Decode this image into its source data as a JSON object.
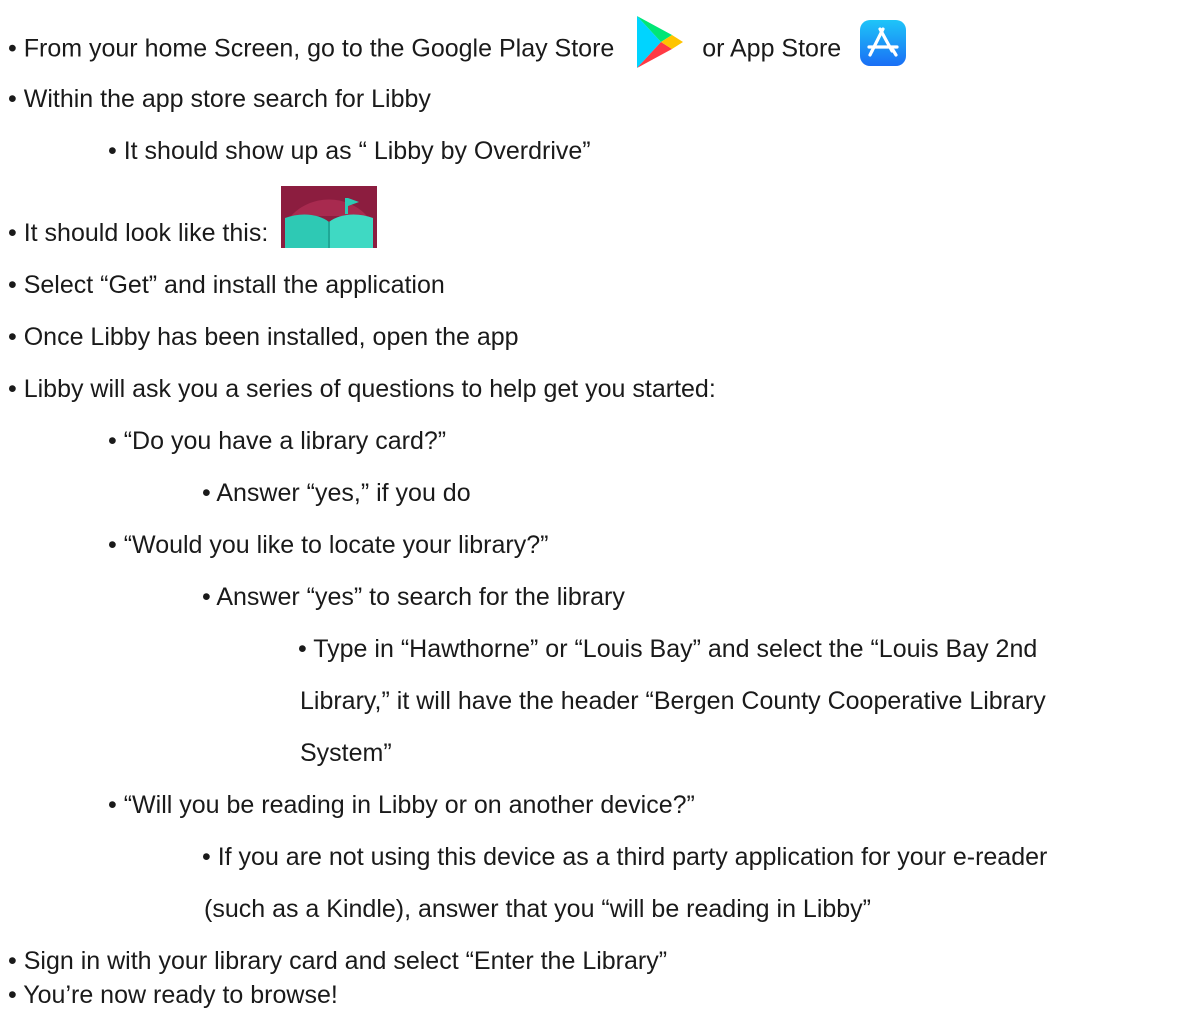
{
  "bullet": "•",
  "icons": {
    "google_play": "google-play-icon",
    "app_store": "app-store-icon",
    "libby": "libby-app-icon"
  },
  "colors": {
    "app_store_blue": "#1a8df5",
    "libby_maroon": "#8c1d3f",
    "libby_teal": "#2ec9b4"
  },
  "lines": {
    "l1_a": "From your home Screen, go to the Google Play Store",
    "l1_b": "or App Store",
    "l2": "Within the app store search for Libby",
    "l3": "It should show up as “ Libby by Overdrive”",
    "l4": "It should look like this:",
    "l5": "Select “Get” and install the application",
    "l6": "Once Libby has been installed, open the app",
    "l7": "Libby will ask you a series of questions to help get you started:",
    "l8": "“Do you have a library card?”",
    "l9": "Answer “yes,” if you do",
    "l10": "“Would you like to locate your library?”",
    "l11": "Answer “yes” to search for the library",
    "l12": "Type in “Hawthorne” or “Louis Bay” and select the “Louis Bay 2nd",
    "l13": "Library,” it will have the header “Bergen County Cooperative Library",
    "l14": "System”",
    "l15": "“Will you be reading in Libby or on another device?”",
    "l16": "If you are not using this device as a third party application for your e-reader",
    "l17": "(such as a Kindle), answer that you “will be reading in Libby”",
    "l18": "Sign in with your library card and select “Enter the Library”",
    "l19": "You’re now ready to browse!"
  }
}
